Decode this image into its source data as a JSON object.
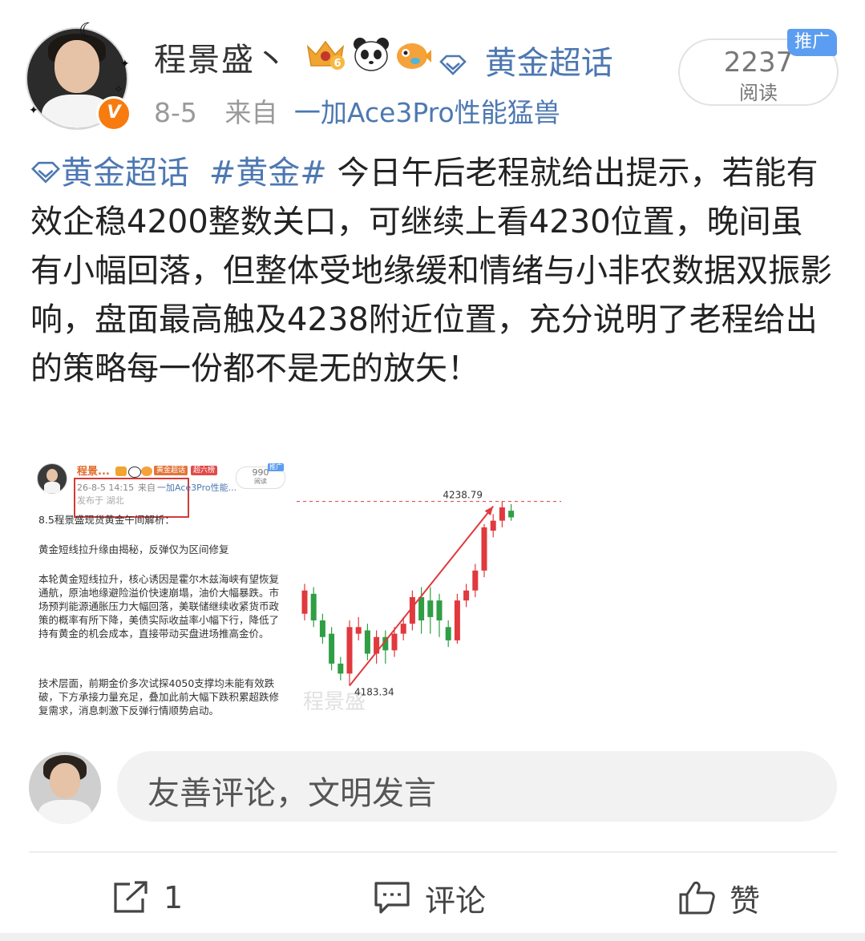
{
  "header": {
    "username": "程景盛丶",
    "topic_label": "黄金超话",
    "date": "8-5",
    "from_label": "来自",
    "source_device": "一加Ace3Pro性能猛兽",
    "reads_count": "2237",
    "reads_label": "阅读",
    "promo_tag": "推广",
    "crown_level": "6"
  },
  "post": {
    "topic_tag": "黄金超话",
    "hashtag": "#黄金#",
    "body": " 今日午后老程就给出提示，若能有效企稳4200整数关口，可继续上看4230位置，晚间虽有小幅回落，但整体受地缘缓和情绪与小非农数据双振影响，盘面最高触及4238附近位置，充分说明了老程给出的策略每一份都不是无的放矢！"
  },
  "embed": {
    "mini_name": "程景...",
    "mini_badge1": "黄金超话",
    "mini_badge2": "超六榜",
    "mini_reads": "990",
    "mini_reads_label": "阅读",
    "mini_promo": "推广",
    "mini_time": "26-8-5 14:15",
    "mini_from": "来自",
    "mini_source": "一加Ace3Pro性能...",
    "mini_location": "发布于 湖北",
    "title": "8.5程景盛现货黄金午间解析：",
    "subtitle": "黄金短线拉升缘由揭秘，反弹仅为区间修复",
    "para1": "本轮黄金短线拉升，核心诱因是霍尔木兹海峡有望恢复通航，原油地缘避险溢价快速崩塌，油价大幅暴跌。市场预判能源通胀压力大幅回落，美联储继续收紧货币政策的概率有所下降，美债实际收益率小幅下行，降低了持有黄金的机会成本，直接带动买盘进场推高金价。",
    "para2": "技术层面，前期金价多次试探4050支撑均未能有效跌破，下方承接力量充足，叠加此前大幅下跌积累超跌修复需求，消息刺激下反弹行情顺势启动。",
    "high_label": "4238.79",
    "low_label": "4183.34",
    "watermark": "程景盛"
  },
  "chart_data": {
    "type": "candlestick",
    "title": "",
    "annotations": [
      "4238.79",
      "4183.34"
    ],
    "candles": [
      {
        "o": 4205,
        "c": 4212,
        "h": 4214,
        "l": 4203,
        "dir": "up"
      },
      {
        "o": 4211,
        "c": 4203,
        "h": 4213,
        "l": 4201,
        "dir": "down"
      },
      {
        "o": 4203,
        "c": 4198,
        "h": 4205,
        "l": 4196,
        "dir": "down"
      },
      {
        "o": 4199,
        "c": 4190,
        "h": 4201,
        "l": 4188,
        "dir": "down"
      },
      {
        "o": 4190,
        "c": 4187,
        "h": 4192,
        "l": 4185,
        "dir": "down"
      },
      {
        "o": 4187,
        "c": 4201,
        "h": 4203,
        "l": 4183.34,
        "dir": "up"
      },
      {
        "o": 4201,
        "c": 4199,
        "h": 4204,
        "l": 4197,
        "dir": "up"
      },
      {
        "o": 4200,
        "c": 4193,
        "h": 4202,
        "l": 4191,
        "dir": "down"
      },
      {
        "o": 4193,
        "c": 4198,
        "h": 4200,
        "l": 4190,
        "dir": "up"
      },
      {
        "o": 4198,
        "c": 4194,
        "h": 4200,
        "l": 4190,
        "dir": "down"
      },
      {
        "o": 4194,
        "c": 4199,
        "h": 4201,
        "l": 4192,
        "dir": "up"
      },
      {
        "o": 4199,
        "c": 4202,
        "h": 4204,
        "l": 4197,
        "dir": "up"
      },
      {
        "o": 4202,
        "c": 4210,
        "h": 4212,
        "l": 4200,
        "dir": "up"
      },
      {
        "o": 4210,
        "c": 4203,
        "h": 4213,
        "l": 4199,
        "dir": "down"
      },
      {
        "o": 4204,
        "c": 4209,
        "h": 4213,
        "l": 4199,
        "dir": "down"
      },
      {
        "o": 4209,
        "c": 4203,
        "h": 4211,
        "l": 4198,
        "dir": "down"
      },
      {
        "o": 4201,
        "c": 4197,
        "h": 4203,
        "l": 4195,
        "dir": "down"
      },
      {
        "o": 4197,
        "c": 4209,
        "h": 4211,
        "l": 4196,
        "dir": "up"
      },
      {
        "o": 4209,
        "c": 4212,
        "h": 4214,
        "l": 4207,
        "dir": "up"
      },
      {
        "o": 4212,
        "c": 4218,
        "h": 4220,
        "l": 4210,
        "dir": "up"
      },
      {
        "o": 4218,
        "c": 4231,
        "h": 4232,
        "l": 4216,
        "dir": "up"
      },
      {
        "o": 4230,
        "c": 4233,
        "h": 4235,
        "l": 4228,
        "dir": "up"
      },
      {
        "o": 4233,
        "c": 4237,
        "h": 4238.79,
        "l": 4231,
        "dir": "up"
      },
      {
        "o": 4236,
        "c": 4234,
        "h": 4238,
        "l": 4233,
        "dir": "down"
      }
    ]
  },
  "comment": {
    "placeholder": "友善评论，文明发言"
  },
  "actions": {
    "share_count": "1",
    "comment_label": "评论",
    "like_label": "赞"
  },
  "colors": {
    "link": "#4d78b2",
    "vip_orange": "#f77b0e",
    "promo_blue": "#5b9df0",
    "candle_up": "#e0393e",
    "candle_down": "#2f9e44"
  }
}
